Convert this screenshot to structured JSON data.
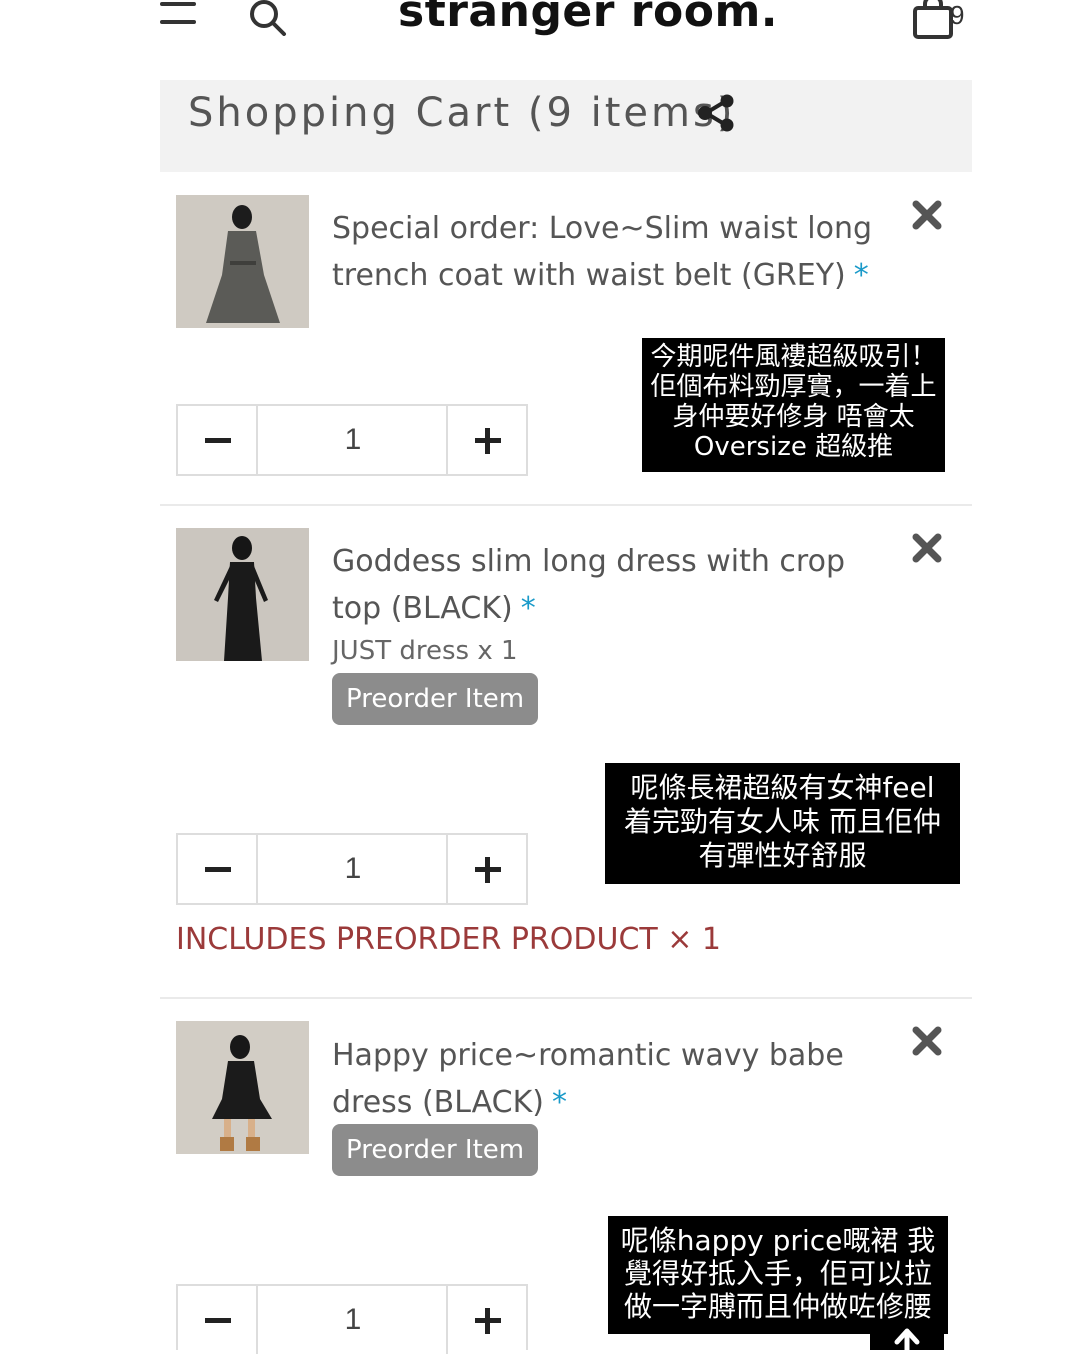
{
  "header": {
    "brand": "stranger room.",
    "cart_count": "9"
  },
  "cart": {
    "title": "Shopping Cart  (9 items)"
  },
  "items": [
    {
      "name": "Special order: Love~Slim waist long trench coat with waist belt (GREY)",
      "asterisk": "*",
      "quantity": "1",
      "caption": [
        "今期呢件風褸超級吸引！",
        "佢個布料勁厚實，一着上",
        "身仲要好修身 唔會太",
        "Oversize 超級推"
      ]
    },
    {
      "name": "Goddess slim long dress with crop top (BLACK)",
      "asterisk": "*",
      "variant": "JUST dress x 1",
      "badge": "Preorder Item",
      "quantity": "1",
      "includes": "INCLUDES PREORDER PRODUCT × 1",
      "caption": [
        "呢條長裙超級有女神feel",
        "着完勁有女人味 而且佢仲",
        "有彈性好舒服"
      ]
    },
    {
      "name": "Happy price~romantic wavy babe dress (BLACK)",
      "asterisk": "*",
      "badge": "Preorder Item",
      "quantity": "1",
      "caption": [
        "呢條happy price嘅裙 我",
        "覺得好抵入手，佢可以拉",
        "做一字膊而且仲做咗修腰"
      ]
    }
  ],
  "colors": {
    "accent_asterisk": "#1a9ac9",
    "preorder_text": "#9b3a3a",
    "badge_bg": "#8c8c8c",
    "caption_bg": "#000000"
  },
  "icons": [
    "menu-icon",
    "search-icon",
    "shopping-bag-icon",
    "share-icon",
    "close-icon",
    "minus-icon",
    "plus-icon",
    "arrow-up-icon"
  ]
}
